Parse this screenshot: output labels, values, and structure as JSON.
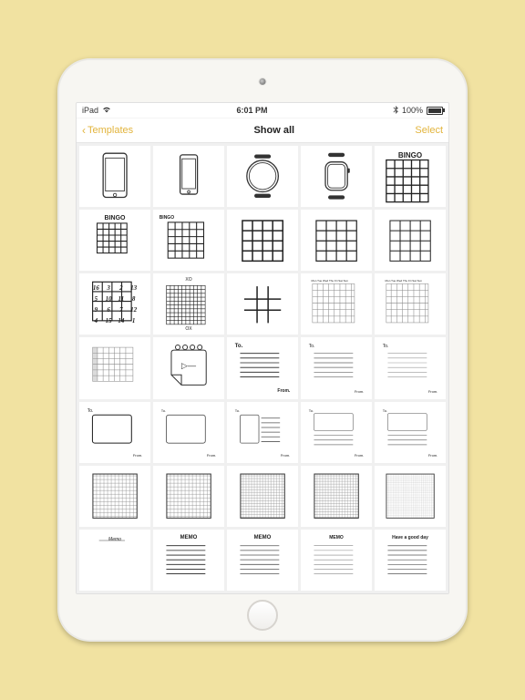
{
  "status": {
    "device": "iPad",
    "time": "6:01 PM",
    "battery": "100%"
  },
  "nav": {
    "back": "Templates",
    "title": "Show all",
    "action": "Select"
  },
  "tiles": {
    "bingo1": "BINGO",
    "bingo2": "BINGO",
    "bingo3": "BINGO",
    "ox1": "XO",
    "ox2": "OX",
    "days": "Mon Tue Wed Thu Fri Sat Sun",
    "to": "To.",
    "from": "From.",
    "memo1": "Memo",
    "memo2": "MEMO",
    "memo3": "MEMO",
    "memo4": "MEMO",
    "goodday": "Have a good day",
    "puzzle": [
      "16",
      "3",
      "2",
      "13",
      "5",
      "10",
      "11",
      "8",
      "9",
      "6",
      "7",
      "12",
      "4",
      "15",
      "14",
      "1"
    ]
  }
}
